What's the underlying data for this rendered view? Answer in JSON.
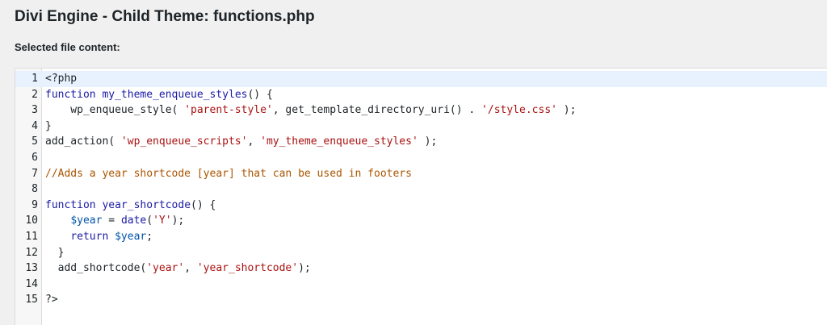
{
  "page": {
    "title": "Divi Engine - Child Theme: functions.php",
    "file_label": "Selected file content:"
  },
  "editor": {
    "language": "php",
    "active_line": 1,
    "lines": [
      {
        "n": "1",
        "tokens": [
          {
            "t": "<?php",
            "c": "plain"
          }
        ]
      },
      {
        "n": "2",
        "tokens": [
          {
            "t": "function",
            "c": "k"
          },
          {
            "t": " ",
            "c": "plain"
          },
          {
            "t": "my_theme_enqueue_styles",
            "c": "f"
          },
          {
            "t": "() {",
            "c": "plain"
          }
        ]
      },
      {
        "n": "3",
        "tokens": [
          {
            "t": "    wp_enqueue_style( ",
            "c": "plain"
          },
          {
            "t": "'parent-style'",
            "c": "s"
          },
          {
            "t": ", get_template_directory_uri() . ",
            "c": "plain"
          },
          {
            "t": "'/style.css'",
            "c": "s"
          },
          {
            "t": " );",
            "c": "plain"
          }
        ]
      },
      {
        "n": "4",
        "tokens": [
          {
            "t": "}",
            "c": "plain"
          }
        ]
      },
      {
        "n": "5",
        "tokens": [
          {
            "t": "add_action( ",
            "c": "plain"
          },
          {
            "t": "'wp_enqueue_scripts'",
            "c": "s"
          },
          {
            "t": ", ",
            "c": "plain"
          },
          {
            "t": "'my_theme_enqueue_styles'",
            "c": "s"
          },
          {
            "t": " );",
            "c": "plain"
          }
        ]
      },
      {
        "n": "6",
        "tokens": []
      },
      {
        "n": "7",
        "tokens": [
          {
            "t": "//Adds a year shortcode [year] that can be used in footers",
            "c": "c"
          }
        ]
      },
      {
        "n": "8",
        "tokens": []
      },
      {
        "n": "9",
        "tokens": [
          {
            "t": "function",
            "c": "k"
          },
          {
            "t": " ",
            "c": "plain"
          },
          {
            "t": "year_shortcode",
            "c": "f"
          },
          {
            "t": "() {",
            "c": "plain"
          }
        ]
      },
      {
        "n": "10",
        "tokens": [
          {
            "t": "    ",
            "c": "plain"
          },
          {
            "t": "$year",
            "c": "v"
          },
          {
            "t": " = ",
            "c": "plain"
          },
          {
            "t": "date",
            "c": "k"
          },
          {
            "t": "(",
            "c": "plain"
          },
          {
            "t": "'Y'",
            "c": "s"
          },
          {
            "t": ");",
            "c": "plain"
          }
        ]
      },
      {
        "n": "11",
        "tokens": [
          {
            "t": "    ",
            "c": "plain"
          },
          {
            "t": "return",
            "c": "k"
          },
          {
            "t": " ",
            "c": "plain"
          },
          {
            "t": "$year",
            "c": "v"
          },
          {
            "t": ";",
            "c": "plain"
          }
        ]
      },
      {
        "n": "12",
        "tokens": [
          {
            "t": "  }",
            "c": "plain"
          }
        ]
      },
      {
        "n": "13",
        "tokens": [
          {
            "t": "  add_shortcode(",
            "c": "plain"
          },
          {
            "t": "'year'",
            "c": "s"
          },
          {
            "t": ", ",
            "c": "plain"
          },
          {
            "t": "'year_shortcode'",
            "c": "s"
          },
          {
            "t": ");",
            "c": "plain"
          }
        ]
      },
      {
        "n": "14",
        "tokens": []
      },
      {
        "n": "15",
        "tokens": [
          {
            "t": "?>",
            "c": "plain"
          }
        ]
      }
    ]
  },
  "colors": {
    "background": "#f0f0f1",
    "editor_bg": "#ffffff",
    "gutter_bg": "#f7f7f7",
    "active_line": "#e8f2fe",
    "keyword": "#1a1aa6",
    "string": "#aa1111",
    "variable": "#0055aa",
    "comment": "#aa5500"
  }
}
